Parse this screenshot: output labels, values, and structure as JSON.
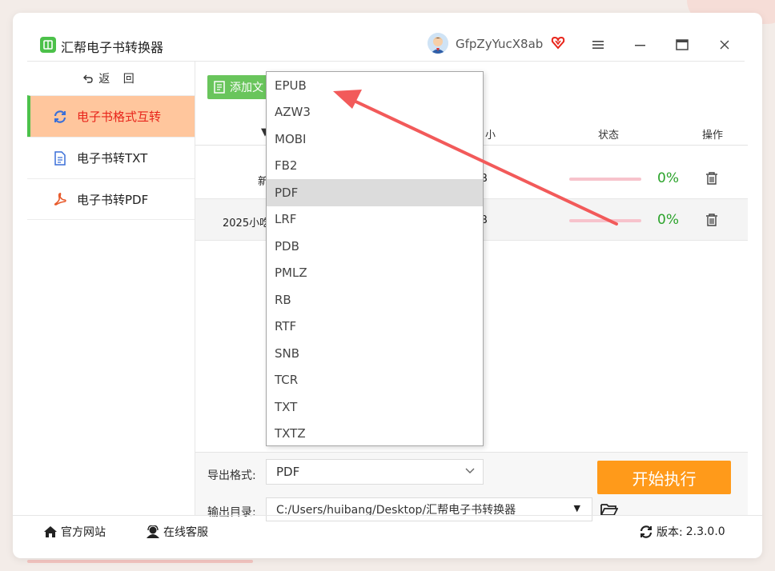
{
  "app": {
    "title": "汇帮电子书转换器",
    "username": "GfpZyYucX8ab"
  },
  "titlebar": {
    "menu_icon": "hamburger-icon",
    "minimize_icon": "minimize-icon",
    "maximize_icon": "maximize-icon",
    "close_icon": "close-icon"
  },
  "sidebar": {
    "back_label": "返 回",
    "items": [
      {
        "label": "电子书格式互转",
        "icon": "refresh-icon",
        "active": true
      },
      {
        "label": "电子书转TXT",
        "icon": "document-icon",
        "active": false
      },
      {
        "label": "电子书转PDF",
        "icon": "pdf-icon",
        "active": false
      }
    ]
  },
  "toolbar": {
    "add_label": "添加文"
  },
  "table": {
    "headers": {
      "name": "▼",
      "size": "小",
      "status": "状态",
      "action": "操作"
    },
    "rows": [
      {
        "name": "新",
        "size": "B",
        "progress": 0,
        "progress_text": "0%"
      },
      {
        "name": "2025小吃",
        "size": "B",
        "progress": 0,
        "progress_text": "0%"
      }
    ]
  },
  "output": {
    "format_label": "导出格式:",
    "format_value": "PDF",
    "dir_label": "输出目录:",
    "dir_value": "C:/Users/huibang/Desktop/汇帮电子书转换器",
    "start_label": "开始执行"
  },
  "format_dropdown": {
    "options": [
      "EPUB",
      "AZW3",
      "MOBI",
      "FB2",
      "PDF",
      "LRF",
      "PDB",
      "PMLZ",
      "RB",
      "RTF",
      "SNB",
      "TCR",
      "TXT",
      "TXTZ"
    ],
    "selected": "PDF"
  },
  "footer": {
    "website_label": "官方网站",
    "support_label": "在线客服",
    "version_label": "版本:",
    "version_value": "2.3.0.0"
  },
  "colors": {
    "accent_orange": "#ff9a1a",
    "accent_green": "#4cc14a",
    "active_bg": "#ffc69d",
    "active_text": "#e8251b",
    "progress_green": "#2ba32b",
    "annotation_red": "#f25a5a"
  }
}
